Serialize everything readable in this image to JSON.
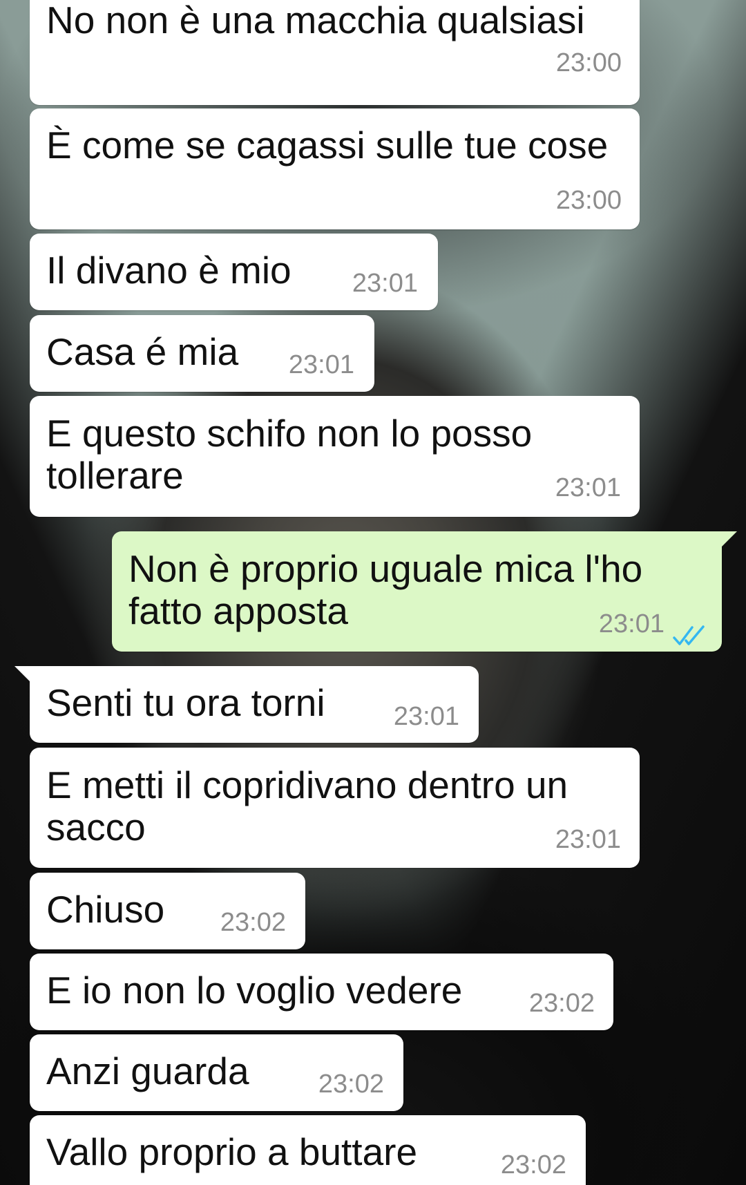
{
  "chat": {
    "messages": [
      {
        "text": "No non è una macchia qualsiasi",
        "time": "23:00",
        "direction": "incoming"
      },
      {
        "text": "È come se cagassi sulle tue cose",
        "time": "23:00",
        "direction": "incoming"
      },
      {
        "text": "Il divano è mio",
        "time": "23:01",
        "direction": "incoming"
      },
      {
        "text": "Casa é mia",
        "time": "23:01",
        "direction": "incoming"
      },
      {
        "text_line1": "E questo schifo non lo posso",
        "text_line2": "tollerare",
        "time": "23:01",
        "direction": "incoming"
      },
      {
        "text_line1": "Non è proprio uguale mica l'ho",
        "text_line2": "fatto apposta",
        "time": "23:01",
        "direction": "outgoing",
        "status": "read"
      },
      {
        "text": "Senti tu ora torni",
        "time": "23:01",
        "direction": "incoming"
      },
      {
        "text_line1": "E metti il copridivano dentro un",
        "text_line2": "sacco",
        "time": "23:01",
        "direction": "incoming"
      },
      {
        "text": "Chiuso",
        "time": "23:02",
        "direction": "incoming"
      },
      {
        "text": "E io non lo voglio vedere",
        "time": "23:02",
        "direction": "incoming"
      },
      {
        "text": "Anzi guarda",
        "time": "23:02",
        "direction": "incoming"
      },
      {
        "text": "Vallo proprio a buttare",
        "time": "23:02",
        "direction": "incoming"
      }
    ]
  },
  "colors": {
    "incoming_bubble": "#ffffff",
    "outgoing_bubble": "#dcf8c6",
    "timestamp": "#8c8c8c",
    "read_ticks": "#34b7f1"
  },
  "icons": {
    "read_receipt": "double-check-icon"
  }
}
